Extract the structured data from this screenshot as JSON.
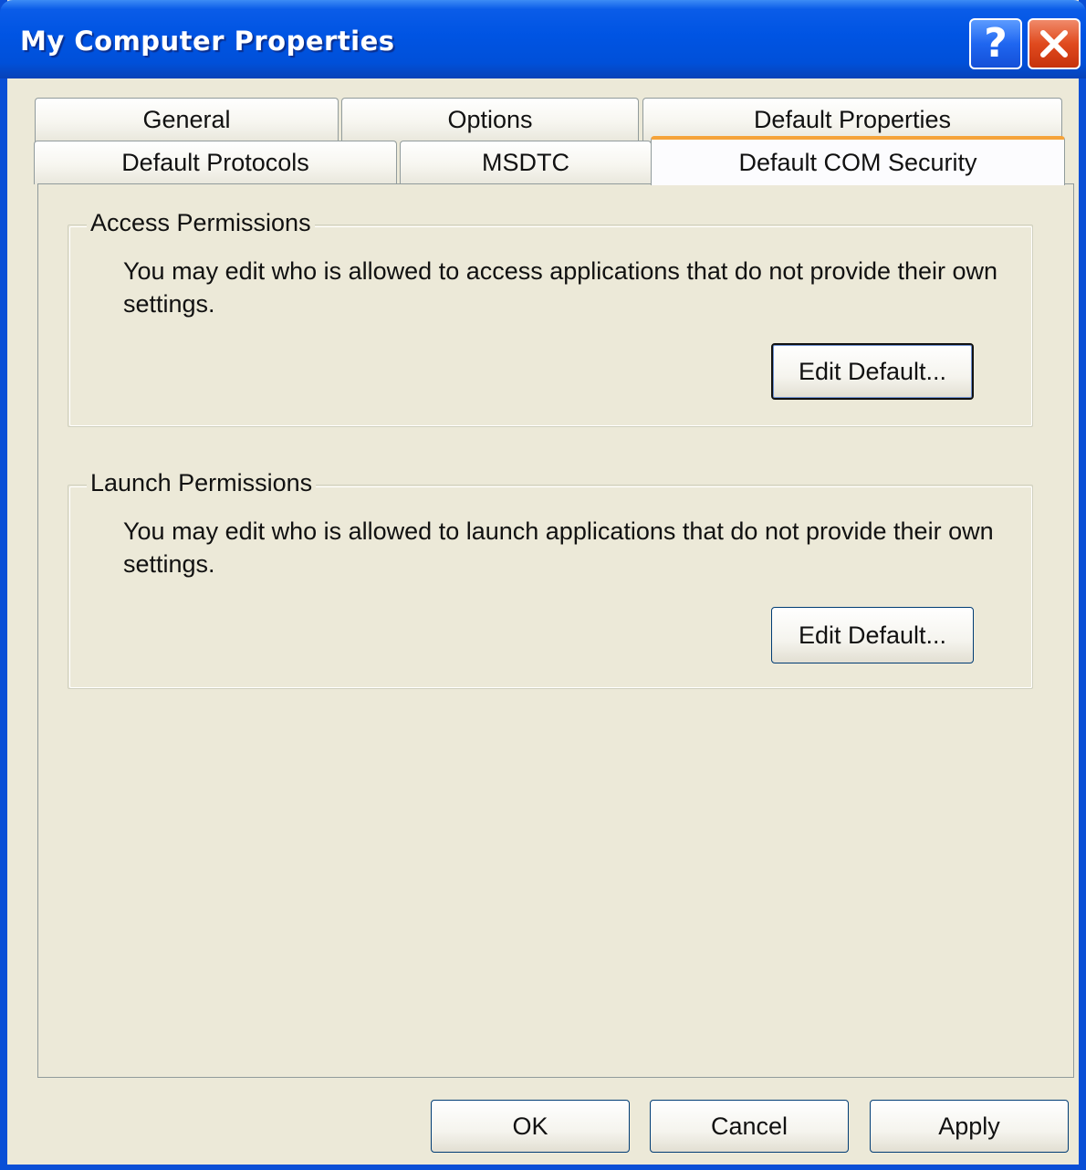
{
  "window": {
    "title": "My Computer Properties",
    "help_glyph": "?",
    "titlebar_color": "#0054e3"
  },
  "tabs": {
    "row1": [
      {
        "label": "General"
      },
      {
        "label": "Options"
      },
      {
        "label": "Default Properties"
      }
    ],
    "row2": [
      {
        "label": "Default Protocols"
      },
      {
        "label": "MSDTC"
      },
      {
        "label": "Default COM Security",
        "active": true
      }
    ],
    "active_accent": "#f5a33a"
  },
  "access": {
    "legend": "Access Permissions",
    "description": "You may edit who is allowed to access applications that do not provide their own settings.",
    "button": "Edit Default..."
  },
  "launch": {
    "legend": "Launch Permissions",
    "description": "You may edit who is allowed to launch applications that do not provide their own settings.",
    "button": "Edit Default..."
  },
  "footer": {
    "ok": "OK",
    "cancel": "Cancel",
    "apply": "Apply"
  }
}
